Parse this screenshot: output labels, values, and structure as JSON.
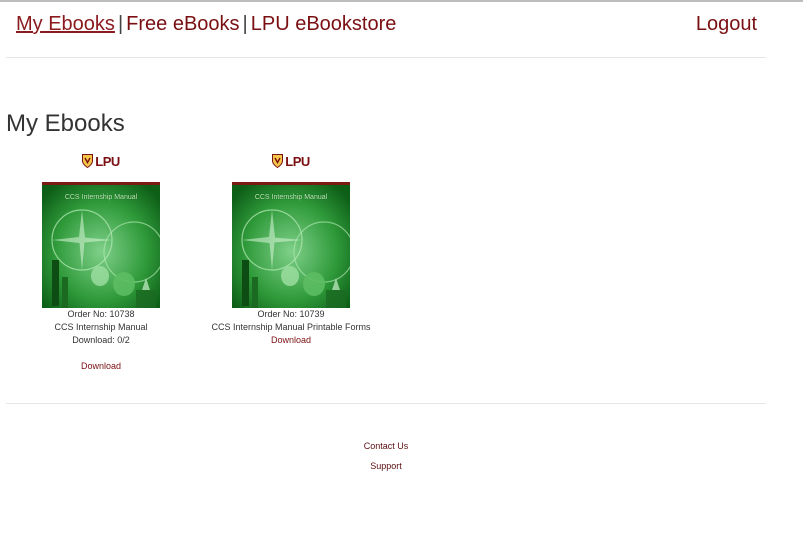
{
  "nav": {
    "my_ebooks": "My Ebooks",
    "sep1": "|",
    "free_ebooks": "Free eBooks",
    "sep2": "|",
    "store": "LPU eBookstore",
    "logout": "Logout"
  },
  "page": {
    "title": "My Ebooks"
  },
  "books": [
    {
      "logo_text": "LPU",
      "cover_title": "CCS Internship Manual",
      "order": "Order No: 10738",
      "name": "CCS Internship Manual",
      "downloads": "Download: 0/2",
      "download_label": "Download"
    },
    {
      "logo_text": "LPU",
      "cover_title": "CCS Internship Manual",
      "order": "Order No: 10739",
      "name": "CCS Internship Manual Printable Forms",
      "download_label": "Download"
    }
  ],
  "footer": {
    "contact": "Contact Us",
    "support": "Support"
  },
  "colors": {
    "brand": "#7a0f12",
    "cover_green": "#1f8a2a"
  },
  "icons": {
    "logo": "lpu-shield-icon"
  }
}
